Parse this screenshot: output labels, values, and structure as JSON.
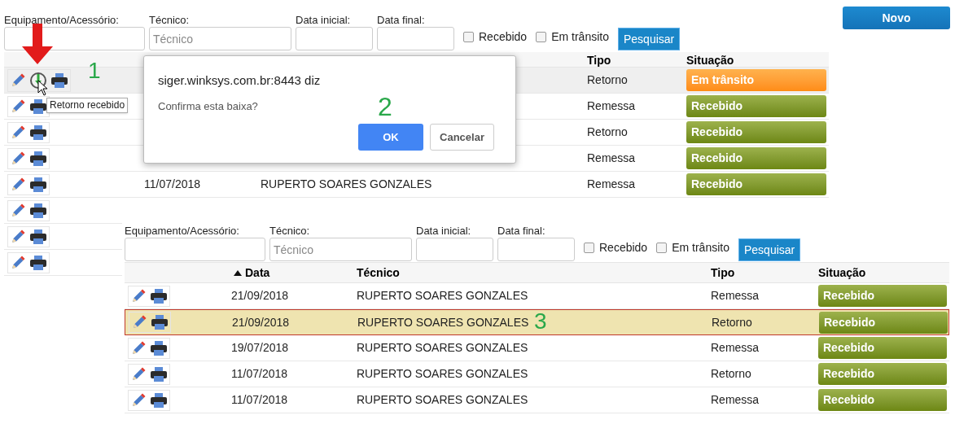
{
  "top_screen": {
    "filters": {
      "fields": [
        {
          "label": "Equipamento/Acessório:"
        },
        {
          "label": "Técnico:",
          "placeholder": "Técnico"
        },
        {
          "label": "Data inicial:"
        },
        {
          "label": "Data final:"
        }
      ],
      "checkboxes": [
        {
          "label": "Recebido",
          "checked": false
        },
        {
          "label": "Em trânsito",
          "checked": false
        }
      ],
      "search_button": "Pesquisar"
    },
    "new_button": "Novo",
    "table": {
      "columns": [
        "Tipo",
        "Situação"
      ],
      "rows": [
        {
          "hovered": true,
          "receive_action": true,
          "tipo": "Retorno",
          "status": {
            "kind": "in_transit",
            "label": "Em trânsito"
          }
        },
        {
          "hovered": false,
          "receive_action": false,
          "tipo": "Remessa",
          "status": {
            "kind": "received",
            "label": "Recebido"
          }
        },
        {
          "hovered": false,
          "receive_action": false,
          "tipo": "Retorno",
          "status": {
            "kind": "received",
            "label": "Recebido"
          }
        },
        {
          "hovered": false,
          "receive_action": false,
          "tipo": "Remessa",
          "status": {
            "kind": "received",
            "label": "Recebido"
          }
        },
        {
          "hovered": false,
          "receive_action": false,
          "date": "11/07/2018",
          "tecnico": "RUPERTO SOARES GONZALES",
          "tipo": "Remessa",
          "status": {
            "kind": "received",
            "label": "Recebido"
          }
        },
        {
          "hovered": false,
          "receive_action": false
        },
        {
          "hovered": false,
          "receive_action": false
        },
        {
          "hovered": false,
          "receive_action": false
        }
      ]
    }
  },
  "tooltip": "Retorno recebido",
  "dialog": {
    "origin": "siger.winksys.com.br:8443 diz",
    "message": "Confirma esta baixa?",
    "ok": "OK",
    "cancel": "Cancelar"
  },
  "bottom_screen": {
    "filters": {
      "fields": [
        {
          "label": "Equipamento/Acessório:"
        },
        {
          "label": "Técnico:",
          "placeholder": "Técnico"
        },
        {
          "label": "Data inicial:"
        },
        {
          "label": "Data final:"
        }
      ],
      "checkboxes": [
        {
          "label": "Recebido",
          "checked": false
        },
        {
          "label": "Em trânsito",
          "checked": false
        }
      ],
      "search_button": "Pesquisar"
    },
    "table": {
      "columns": [
        "Data",
        "Técnico",
        "Tipo",
        "Situação"
      ],
      "rows": [
        {
          "selected": false,
          "date": "21/09/2018",
          "tecnico": "RUPERTO SOARES GONZALES",
          "tipo": "Remessa",
          "status": {
            "kind": "received",
            "label": "Recebido"
          }
        },
        {
          "selected": true,
          "date": "21/09/2018",
          "tecnico": "RUPERTO SOARES GONZALES",
          "tipo": "Retorno",
          "status": {
            "kind": "received",
            "label": "Recebido"
          }
        },
        {
          "selected": false,
          "date": "19/07/2018",
          "tecnico": "RUPERTO SOARES GONZALES",
          "tipo": "Remessa",
          "status": {
            "kind": "received",
            "label": "Recebido"
          }
        },
        {
          "selected": false,
          "date": "11/07/2018",
          "tecnico": "RUPERTO SOARES GONZALES",
          "tipo": "Retorno",
          "status": {
            "kind": "received",
            "label": "Recebido"
          }
        },
        {
          "selected": false,
          "date": "11/07/2018",
          "tecnico": "RUPERTO SOARES GONZALES",
          "tipo": "Remessa",
          "status": {
            "kind": "received",
            "label": "Recebido"
          }
        }
      ]
    }
  },
  "annotations": [
    "1",
    "2",
    "3"
  ]
}
